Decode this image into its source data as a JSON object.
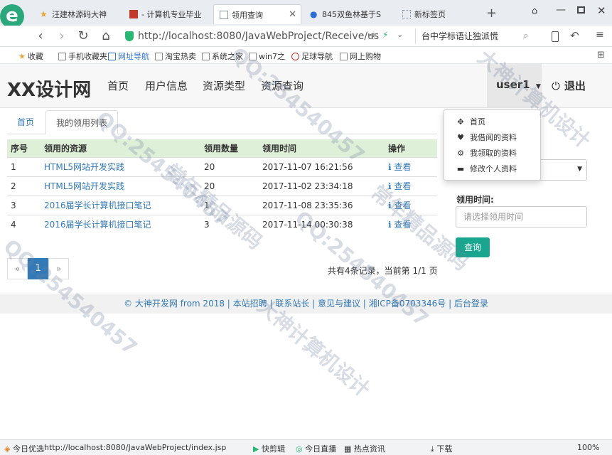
{
  "browser": {
    "tabs": [
      {
        "title": "汪建林源码大神",
        "icon": "star-icon",
        "color": "#e8a33b"
      },
      {
        "title": "- 计算机专业毕业",
        "icon": "red-square-icon",
        "color": "#c0392b"
      },
      {
        "title": "领用查询",
        "icon": "page-icon",
        "color": "#8a96a3"
      },
      {
        "title": "845双鱼林基于S",
        "icon": "paw-icon",
        "color": "#2b6fd6"
      },
      {
        "title": "新标签页",
        "icon": "grid-icon",
        "color": "#8a96a3"
      }
    ],
    "new_tab": "+",
    "url": "http://localhost:8080/JavaWebProject/Receive/us",
    "search_text": "台中学标语让独派慌",
    "bookmarks": [
      "收藏",
      "手机收藏夹",
      "网址导航",
      "淘宝热卖",
      "系统之家",
      "win7之",
      "足球导航",
      "网上购物"
    ]
  },
  "site": {
    "brand": "XX设计网",
    "nav": [
      "首页",
      "用户信息",
      "资源类型",
      "资源查询"
    ],
    "user": "user1",
    "logout": "退出"
  },
  "crumbs": {
    "home": "首页",
    "current": "我的领用列表"
  },
  "table": {
    "headers": [
      "序号",
      "领用的资源",
      "领用数量",
      "领用时间",
      "操作"
    ],
    "rows": [
      {
        "no": "1",
        "resource": "HTML5网站开发实践",
        "qty": "20",
        "time": "2017-11-07 16:21:56",
        "action": "查看"
      },
      {
        "no": "2",
        "resource": "HTML5网站开发实践",
        "qty": "20",
        "time": "2017-11-02 23:34:18",
        "action": "查看"
      },
      {
        "no": "3",
        "resource": "2016届学长计算机接口笔记",
        "qty": "1",
        "time": "2017-11-08 23:35:36",
        "action": "查看"
      },
      {
        "no": "4",
        "resource": "2016届学长计算机接口笔记",
        "qty": "3",
        "time": "2017-11-14 00:30:38",
        "action": "查看"
      }
    ]
  },
  "pager": {
    "prev": "«",
    "current": "1",
    "next": "»",
    "info": "共有4条记录，当前第 1/1 页"
  },
  "filter": {
    "time_label": "领用时间:",
    "time_placeholder": "请选择领用时间",
    "query_button": "查询"
  },
  "dropdown": [
    {
      "label": "首页",
      "icon": "move-icon"
    },
    {
      "label": "我借阅的资料",
      "icon": "heart-icon"
    },
    {
      "label": "我领取的资料",
      "icon": "gear-icon"
    },
    {
      "label": "修改个人资料",
      "icon": "card-icon"
    }
  ],
  "footer": "© 大神开发网 from 2018 | 本站招聘 | 联系站长 | 意见与建议 | 湘ICP备0703346号 | 后台登录",
  "statusbar": {
    "left": "今日优选",
    "url": "http://localhost:8080/JavaWebProject/index.jsp",
    "items": [
      "快剪辑",
      "今日直播",
      "热点资讯",
      "下载",
      "100%"
    ]
  },
  "watermarks": [
    "QQ:254540457",
    "大神计算机设计",
    "常年精品源码"
  ]
}
